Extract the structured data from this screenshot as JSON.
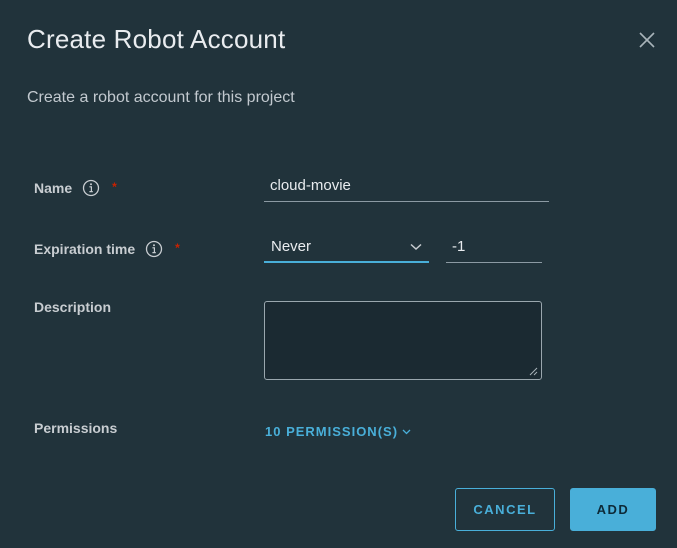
{
  "modal": {
    "title": "Create Robot Account",
    "subtitle": "Create a robot account for this project"
  },
  "form": {
    "name": {
      "label": "Name",
      "required_mark": "*",
      "value": "cloud-movie"
    },
    "expiration": {
      "label": "Expiration time",
      "required_mark": "*",
      "selected": "Never",
      "days_value": "-1"
    },
    "description": {
      "label": "Description",
      "value": ""
    },
    "permissions": {
      "label": "Permissions",
      "link": "10 PERMISSION(S)"
    }
  },
  "actions": {
    "cancel_label": "CANCEL",
    "add_label": "ADD"
  },
  "colors": {
    "background": "#21333b",
    "accent": "#49afd9",
    "required": "#c92100"
  },
  "icons": [
    "close-icon",
    "info-icon",
    "chevron-down-icon",
    "resize-grip-icon"
  ]
}
